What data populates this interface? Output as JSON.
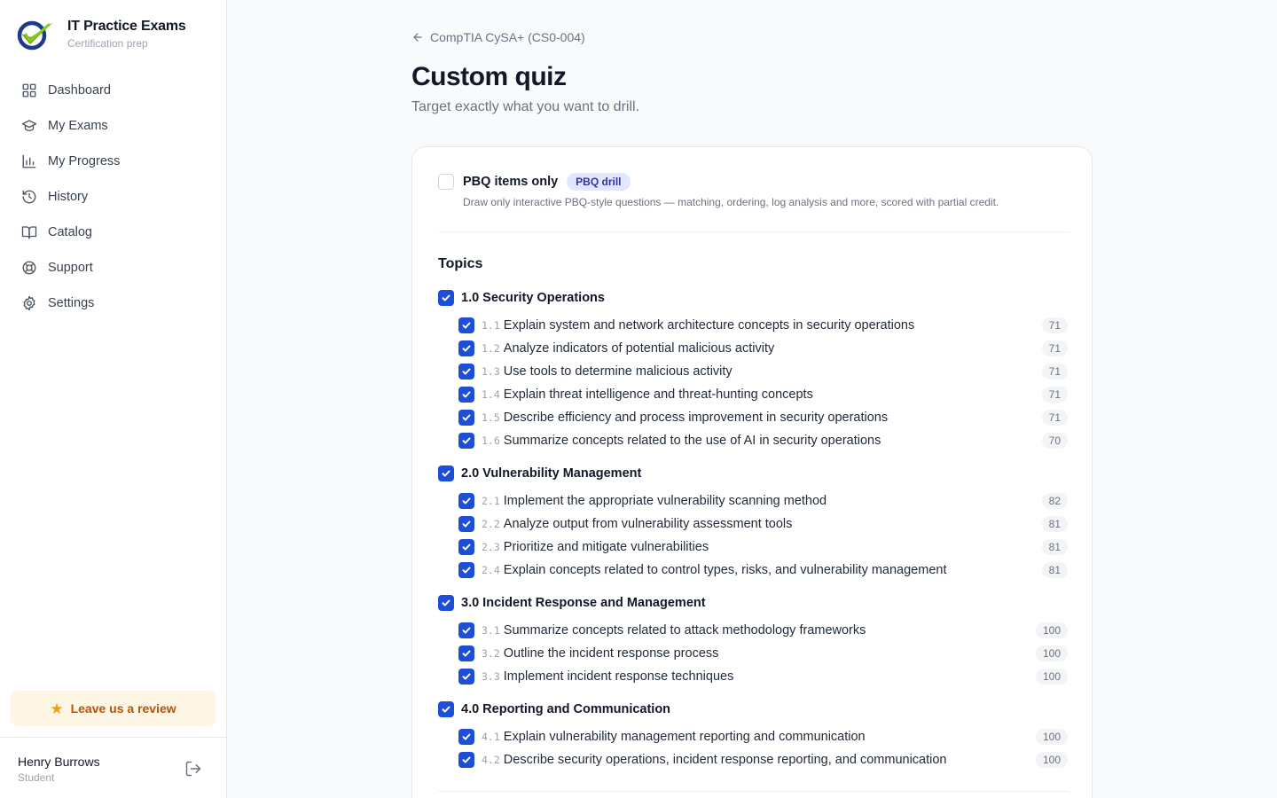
{
  "brand": {
    "name": "IT Practice Exams",
    "subtitle": "Certification prep"
  },
  "nav": [
    {
      "label": "Dashboard",
      "icon": "grid-icon"
    },
    {
      "label": "My Exams",
      "icon": "graduation-cap-icon"
    },
    {
      "label": "My Progress",
      "icon": "bar-chart-icon"
    },
    {
      "label": "History",
      "icon": "history-icon"
    },
    {
      "label": "Catalog",
      "icon": "book-icon"
    },
    {
      "label": "Support",
      "icon": "lifebuoy-icon"
    },
    {
      "label": "Settings",
      "icon": "gear-icon"
    }
  ],
  "review": {
    "label": "Leave us a review"
  },
  "user": {
    "name": "Henry Burrows",
    "role": "Student"
  },
  "breadcrumb": {
    "label": "CompTIA CySA+ (CS0-004)"
  },
  "page": {
    "title": "Custom quiz",
    "subtitle": "Target exactly what you want to drill."
  },
  "pbq": {
    "label": "PBQ items only",
    "badge": "PBQ drill",
    "checked": false,
    "description": "Draw only interactive PBQ-style questions — matching, ordering, log analysis and more, scored with partial credit."
  },
  "topics": {
    "title": "Topics",
    "domains": [
      {
        "label": "1.0 Security Operations",
        "checked": true,
        "objectives": [
          {
            "num": "1.1",
            "label": "Explain system and network architecture concepts in security operations",
            "count": "71",
            "checked": true
          },
          {
            "num": "1.2",
            "label": "Analyze indicators of potential malicious activity",
            "count": "71",
            "checked": true
          },
          {
            "num": "1.3",
            "label": "Use tools to determine malicious activity",
            "count": "71",
            "checked": true
          },
          {
            "num": "1.4",
            "label": "Explain threat intelligence and threat-hunting concepts",
            "count": "71",
            "checked": true
          },
          {
            "num": "1.5",
            "label": "Describe efficiency and process improvement in security operations",
            "count": "71",
            "checked": true
          },
          {
            "num": "1.6",
            "label": "Summarize concepts related to the use of AI in security operations",
            "count": "70",
            "checked": true
          }
        ]
      },
      {
        "label": "2.0 Vulnerability Management",
        "checked": true,
        "objectives": [
          {
            "num": "2.1",
            "label": "Implement the appropriate vulnerability scanning method",
            "count": "82",
            "checked": true
          },
          {
            "num": "2.2",
            "label": "Analyze output from vulnerability assessment tools",
            "count": "81",
            "checked": true
          },
          {
            "num": "2.3",
            "label": "Prioritize and mitigate vulnerabilities",
            "count": "81",
            "checked": true
          },
          {
            "num": "2.4",
            "label": "Explain concepts related to control types, risks, and vulnerability management",
            "count": "81",
            "checked": true
          }
        ]
      },
      {
        "label": "3.0 Incident Response and Management",
        "checked": true,
        "objectives": [
          {
            "num": "3.1",
            "label": "Summarize concepts related to attack methodology frameworks",
            "count": "100",
            "checked": true
          },
          {
            "num": "3.2",
            "label": "Outline the incident response process",
            "count": "100",
            "checked": true
          },
          {
            "num": "3.3",
            "label": "Implement incident response techniques",
            "count": "100",
            "checked": true
          }
        ]
      },
      {
        "label": "4.0 Reporting and Communication",
        "checked": true,
        "objectives": [
          {
            "num": "4.1",
            "label": "Explain vulnerability management reporting and communication",
            "count": "100",
            "checked": true
          },
          {
            "num": "4.2",
            "label": "Describe security operations, incident response reporting, and communication",
            "count": "100",
            "checked": true
          }
        ]
      }
    ]
  },
  "colors": {
    "accent": "#1d4ed8",
    "review_bg": "#fef6e4",
    "review_text": "#b45309",
    "badge_bg": "#e0e7ff",
    "badge_text": "#3730a3"
  }
}
